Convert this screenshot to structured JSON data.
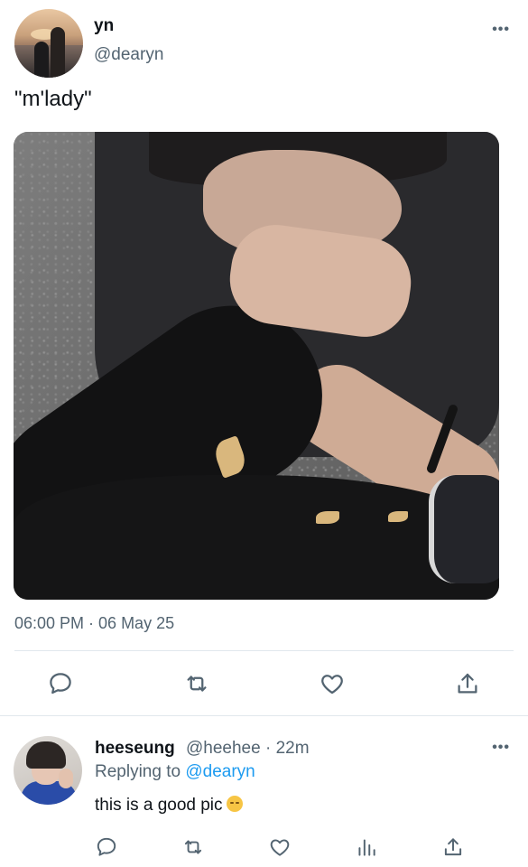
{
  "tweet": {
    "author": {
      "display_name": "yn",
      "handle": "@dearyn"
    },
    "text": "\"m'lady\"",
    "timestamp": "06:00 PM · 06 May 25",
    "more_icon": "more-horizontal-icon",
    "media": {
      "type": "photo"
    },
    "actions": [
      {
        "name": "reply",
        "icon": "comment-icon"
      },
      {
        "name": "retweet",
        "icon": "retweet-icon"
      },
      {
        "name": "like",
        "icon": "heart-icon"
      },
      {
        "name": "share",
        "icon": "share-icon"
      }
    ]
  },
  "reply": {
    "author": {
      "display_name": "heeseung",
      "handle": "@heehee",
      "time": "22m"
    },
    "meta_text": "@heehee · 22m",
    "replying_prefix": "Replying to",
    "replying_to": "@dearyn",
    "text": "this is a good pic",
    "emoji": "pensive-face",
    "actions": [
      {
        "name": "reply",
        "icon": "comment-icon"
      },
      {
        "name": "retweet",
        "icon": "retweet-icon"
      },
      {
        "name": "like",
        "icon": "heart-icon"
      },
      {
        "name": "views",
        "icon": "bar-chart-icon"
      },
      {
        "name": "share",
        "icon": "share-icon"
      }
    ]
  },
  "colors": {
    "text": "#0f1419",
    "muted": "#536471",
    "link": "#1d9bf0",
    "divider": "#e1e8ed"
  }
}
